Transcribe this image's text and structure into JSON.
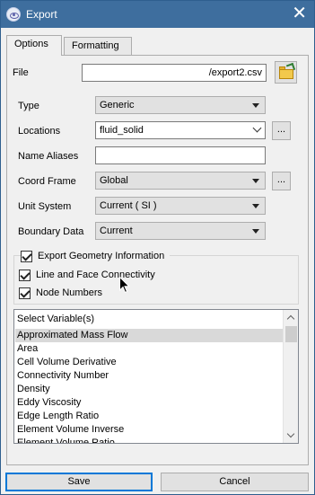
{
  "window": {
    "title": "Export"
  },
  "tabs": [
    {
      "label": "Options",
      "active": true
    },
    {
      "label": "Formatting",
      "active": false
    }
  ],
  "file": {
    "label": "File",
    "value": "/export2.csv"
  },
  "form": {
    "type": {
      "label": "Type",
      "value": "Generic"
    },
    "locations": {
      "label": "Locations",
      "value": "fluid_solid"
    },
    "name_aliases": {
      "label": "Name Aliases",
      "value": ""
    },
    "coord_frame": {
      "label": "Coord Frame",
      "value": "Global"
    },
    "unit_system": {
      "label": "Unit System",
      "value": "Current ( SI )"
    },
    "boundary_data": {
      "label": "Boundary Data",
      "value": "Current"
    },
    "ellipsis": "..."
  },
  "options": {
    "export_geometry": {
      "label": "Export Geometry Information",
      "checked": true
    },
    "line_face_connectivity": {
      "label": "Line and Face Connectivity",
      "checked": true
    },
    "node_numbers": {
      "label": "Node Numbers",
      "checked": true
    }
  },
  "variables": {
    "header": "Select Variable(s)",
    "items": [
      "Approximated Mass Flow",
      "Area",
      "Cell Volume Derivative",
      "Connectivity Number",
      "Density",
      "Eddy Viscosity",
      "Edge Length Ratio",
      "Element Volume Inverse",
      "Element Volume Ratio"
    ],
    "selected_index": 0
  },
  "buttons": {
    "save": "Save",
    "cancel": "Cancel"
  },
  "icons": {
    "app": "app-eye-icon",
    "close": "close-icon",
    "folder": "folder-open-icon"
  }
}
